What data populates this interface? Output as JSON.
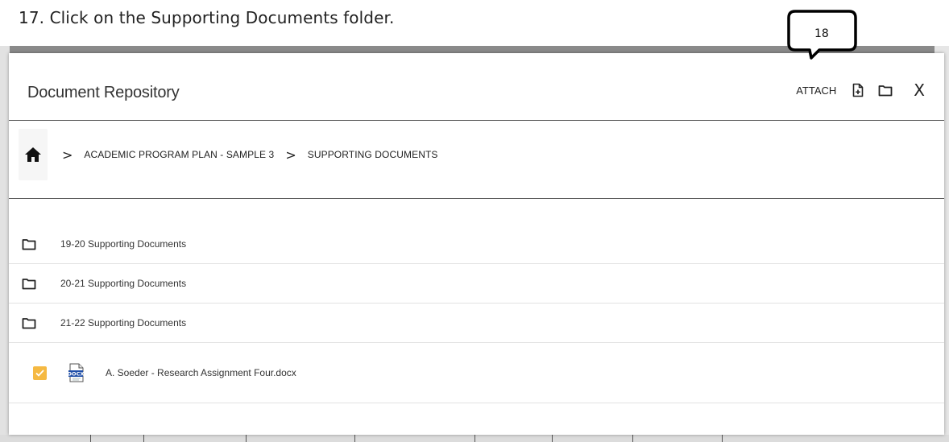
{
  "caption": {
    "text": "17.  Click on the Supporting Documents folder."
  },
  "callout": {
    "number": "18"
  },
  "modal": {
    "title": "Document Repository",
    "actions": {
      "attach_label": "ATTACH",
      "new_file_icon": "file-plus-icon",
      "new_folder_icon": "folder-icon",
      "close_label": "X"
    }
  },
  "breadcrumb": {
    "home_icon": "home-icon",
    "separator": ">",
    "items": [
      {
        "label": "ACADEMIC PROGRAM PLAN - SAMPLE 3"
      },
      {
        "label": "SUPPORTING DOCUMENTS"
      }
    ]
  },
  "files": {
    "folders": [
      {
        "name": "19-20 Supporting Documents",
        "icon": "folder-icon"
      },
      {
        "name": "20-21 Supporting Documents",
        "icon": "folder-icon"
      },
      {
        "name": "21-22 Supporting Documents",
        "icon": "folder-icon"
      }
    ],
    "documents": [
      {
        "name": "A. Soeder - Research Assignment Four.docx",
        "icon": "docx-icon",
        "badge": "DOCX",
        "checked": true
      }
    ]
  },
  "colors": {
    "checkbox": "#f5b942",
    "backdrop": "#8a8a8a",
    "docx_badge": "#1f4fa8"
  }
}
